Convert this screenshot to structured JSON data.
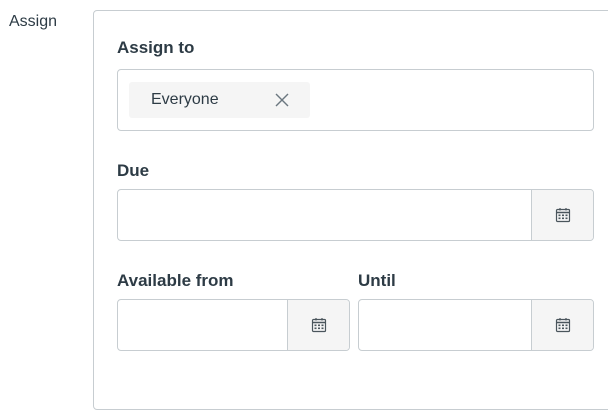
{
  "row": {
    "label": "Assign"
  },
  "assign_to": {
    "label": "Assign to",
    "tokens": [
      {
        "label": "Everyone",
        "remove_icon": "close-icon"
      }
    ]
  },
  "due": {
    "label": "Due",
    "value": "",
    "icon": "calendar-icon"
  },
  "available_from": {
    "label": "Available from",
    "value": "",
    "icon": "calendar-icon"
  },
  "until": {
    "label": "Until",
    "value": "",
    "icon": "calendar-icon"
  },
  "colors": {
    "text": "#2d3b45",
    "border": "#c7cdd1",
    "token_bg": "#f5f5f5",
    "icon": "#6b7780"
  }
}
